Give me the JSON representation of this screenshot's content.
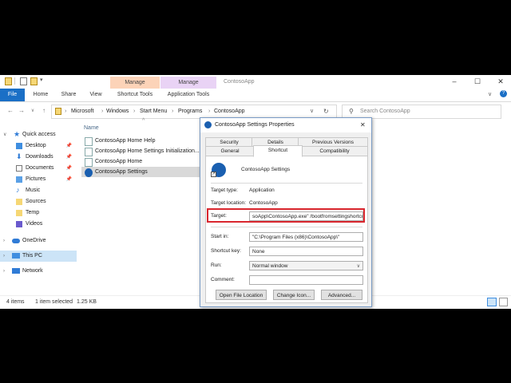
{
  "titlebar": {
    "ctx_tabs": [
      {
        "label": "Manage",
        "color": "#fcd3b8"
      },
      {
        "label": "Manage",
        "color": "#e9d3f5"
      }
    ],
    "window_title": "ContosoApp"
  },
  "ribbon": {
    "tabs": [
      "File",
      "Home",
      "Share",
      "View",
      "Shortcut Tools",
      "Application Tools"
    ]
  },
  "address": {
    "crumbs": [
      "Microsoft",
      "Windows",
      "Start Menu",
      "Programs",
      "ContosoApp"
    ],
    "search_placeholder": "Search ContosoApp"
  },
  "navpane": {
    "quick_access": "Quick access",
    "items": [
      "Desktop",
      "Downloads",
      "Documents",
      "Pictures",
      "Music",
      "Sources",
      "Temp",
      "Videos"
    ],
    "onedrive": "OneDrive",
    "this_pc": "This PC",
    "network": "Network"
  },
  "filelist": {
    "column_name": "Name",
    "files": [
      "ContosoApp Home Help",
      "ContosoApp Home Settings Initialization...",
      "ContosoApp Home",
      "ContosoApp Settings"
    ]
  },
  "status": {
    "count": "4 items",
    "selected": "1 item selected",
    "size": "1.25 KB"
  },
  "dialog": {
    "title": "ContosoApp Settings Properties",
    "tabs_row1": [
      "Security",
      "Details",
      "Previous Versions"
    ],
    "tabs_row2": [
      "General",
      "Shortcut",
      "Compatibility"
    ],
    "name": "ContosoApp Settings",
    "target_type_label": "Target type:",
    "target_type": "Application",
    "target_location_label": "Target location:",
    "target_location": "ContosoApp",
    "target_label": "Target:",
    "target": "soApp\\ContosoApp.exe\" /bootfromsettingshortcut",
    "start_in_label": "Start in:",
    "start_in": "\"C:\\Program Files (x86)\\ContosoApp\\\"",
    "shortcut_key_label": "Shortcut key:",
    "shortcut_key": "None",
    "run_label": "Run:",
    "run": "Normal window",
    "comment_label": "Comment:",
    "comment": "",
    "buttons": [
      "Open File Location",
      "Change Icon...",
      "Advanced..."
    ]
  }
}
